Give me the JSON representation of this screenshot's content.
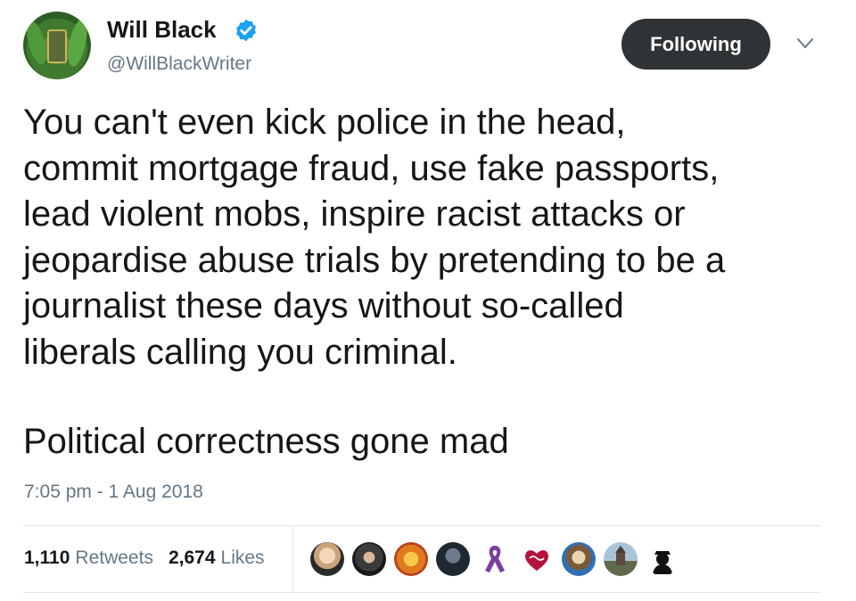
{
  "author": {
    "display_name": "Will Black",
    "handle": "@WillBlackWriter",
    "verified": true
  },
  "actions": {
    "follow_label": "Following"
  },
  "tweet": {
    "text": "You can't even kick police in the head,\ncommit mortgage fraud, use fake passports,\nlead violent mobs, inspire racist attacks or\njeopardise abuse trials by pretending to be a\njournalist these days without so-called\nliberals calling you criminal.",
    "text_second": "Political correctness gone mad",
    "timestamp": "7:05 pm - 1 Aug 2018"
  },
  "stats": {
    "retweets_count": "1,110",
    "retweets_label": "Retweets",
    "likes_count": "2,674",
    "likes_label": "Likes"
  },
  "likers": [
    "avatar",
    "avatar",
    "avatar",
    "avatar",
    "purple-ribbon-icon",
    "heart-badge-icon",
    "avatar",
    "avatar",
    "silhouette-icon"
  ],
  "colors": {
    "verified_blue": "#1da1f2",
    "button_bg": "#2f3336",
    "secondary_text": "#657786",
    "divider": "#e1e8ed"
  }
}
